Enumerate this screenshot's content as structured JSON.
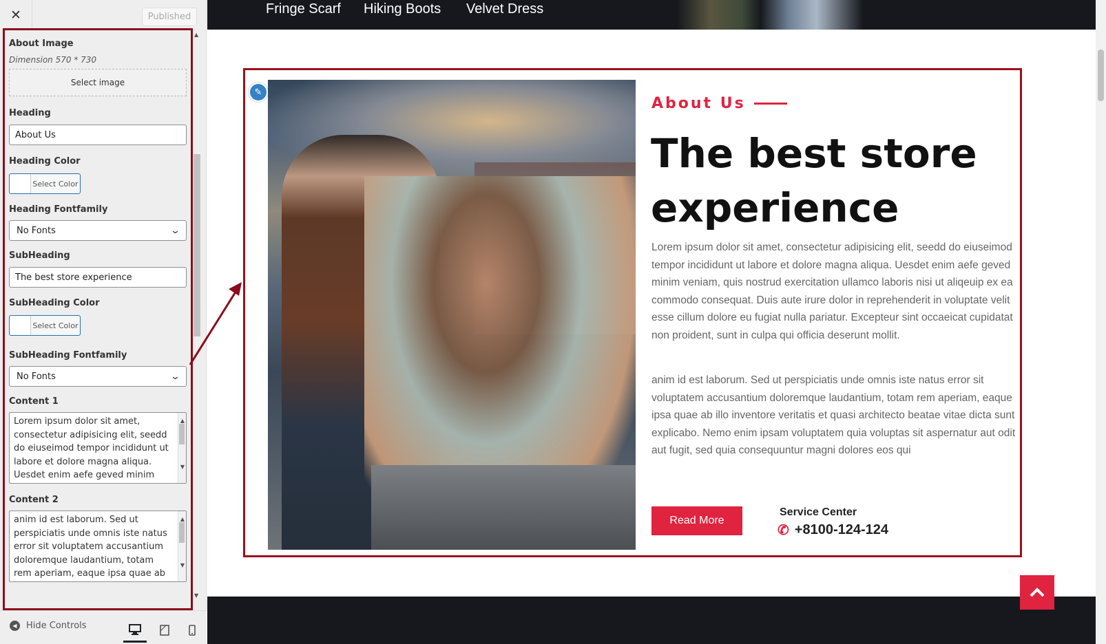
{
  "sidebar": {
    "close_label": "✕",
    "published_label": "Published",
    "fields": {
      "about_image": {
        "label": "About Image",
        "note": "Dimension 570 * 730",
        "button": "Select image"
      },
      "heading": {
        "label": "Heading",
        "value": "About Us"
      },
      "heading_color": {
        "label": "Heading Color",
        "button": "Select Color"
      },
      "heading_fontfamily": {
        "label": "Heading Fontfamily",
        "value": "No Fonts"
      },
      "subheading": {
        "label": "SubHeading",
        "value": "The best store experience"
      },
      "subheading_color": {
        "label": "SubHeading Color",
        "button": "Select Color"
      },
      "subheading_fontfamily": {
        "label": "SubHeading Fontfamily",
        "value": "No Fonts"
      },
      "content1": {
        "label": "Content 1",
        "value": "Lorem ipsum dolor sit amet, consectetur adipisicing elit, seedd do eiuseimod tempor incididunt ut labore et dolore magna aliqua. Uesdet enim aefe geved minim"
      },
      "content2": {
        "label": "Content 2",
        "value": "anim id est laborum. Sed ut perspiciatis unde omnis iste natus error sit voluptatem accusantium doloremque laudantium, totam rem aperiam, eaque ipsa quae ab illo"
      }
    },
    "footer": {
      "hide_controls": "Hide Controls"
    }
  },
  "nav": {
    "items": [
      "Fringe Scarf",
      "Hiking Boots",
      "Velvet Dress"
    ]
  },
  "about": {
    "small_heading": "About Us",
    "title": "The best store experience",
    "paragraph1": "Lorem ipsum dolor sit amet, consectetur adipisicing elit, seedd do eiuseimod tempor incididunt ut labore et dolore magna aliqua. Uesdet enim aefe geved minim veniam, quis nostrud exercitation ullamco laboris nisi ut aliqeuip ex ea commodo consequat. Duis aute irure dolor in reprehenderit in voluptate velit esse cillum dolore eu fugiat nulla pariatur. Excepteur sint occaeicat cupidatat non proident, sunt in culpa qui officia deserunt mollit.",
    "paragraph2": "anim id est laborum. Sed ut perspiciatis unde omnis iste natus error sit voluptatem accusantium doloremque laudantium, totam rem aperiam, eaque ipsa quae ab illo inventore veritatis et quasi architecto beatae vitae dicta sunt explicabo. Nemo enim ipsam voluptatem quia voluptas sit aspernatur aut odit aut fugit, sed quia consequuntur magni dolores eos qui",
    "button": "Read More",
    "service_label": "Service Center",
    "phone": "+8100-124-124"
  },
  "colors": {
    "accent": "#e0233f",
    "highlight_border": "#9b0e1e",
    "dark_bar": "#16181d"
  },
  "icons": {
    "close": "close-icon",
    "pencil": "pencil-icon",
    "phone": "phone-icon",
    "up": "chevron-up-icon",
    "desktop": "desktop-icon",
    "tablet": "tablet-icon",
    "mobile": "mobile-icon"
  }
}
